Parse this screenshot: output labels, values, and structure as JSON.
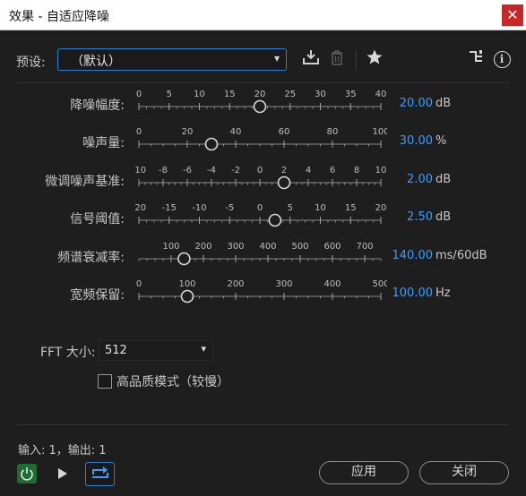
{
  "window": {
    "title": "效果 - 自适应降噪",
    "close_label": "✕"
  },
  "preset": {
    "label": "预设:",
    "value": "（默认）"
  },
  "toolbar_icons": [
    "download-preset-icon",
    "delete-preset-icon",
    "favorite-star-icon",
    "routing-icon",
    "info-icon"
  ],
  "info_glyph": "i",
  "params": [
    {
      "label": "降噪幅度:",
      "value": "20.00",
      "unit": "dB",
      "ticks": [
        "0",
        "5",
        "10",
        "15",
        "20",
        "25",
        "30",
        "35",
        "40"
      ],
      "min": 0,
      "max": 40,
      "current": 20
    },
    {
      "label": "噪声量:",
      "value": "30.00",
      "unit": "%",
      "ticks": [
        "0",
        "20",
        "40",
        "60",
        "80",
        "100"
      ],
      "min": 0,
      "max": 100,
      "current": 30
    },
    {
      "label": "微调噪声基准:",
      "value": "2.00",
      "unit": "dB",
      "ticks": [
        "-10",
        "-8",
        "-6",
        "-4",
        "-2",
        "0",
        "2",
        "4",
        "6",
        "8",
        "10"
      ],
      "min": -10,
      "max": 10,
      "current": 2
    },
    {
      "label": "信号阈值:",
      "value": "2.50",
      "unit": "dB",
      "ticks": [
        "-20",
        "-15",
        "-10",
        "-5",
        "0",
        "5",
        "10",
        "15",
        "20"
      ],
      "min": -20,
      "max": 20,
      "current": 2.5
    },
    {
      "label": "频谱衰减率:",
      "value": "140.00",
      "unit": "ms/60dB",
      "ticks": [
        "100",
        "200",
        "300",
        "400",
        "500",
        "600",
        "700"
      ],
      "min": 0,
      "max": 750,
      "current": 140,
      "tick_start": 100
    },
    {
      "label": "宽频保留:",
      "value": "100.00",
      "unit": "Hz",
      "ticks": [
        "0",
        "100",
        "200",
        "300",
        "400",
        "500"
      ],
      "min": 0,
      "max": 500,
      "current": 100
    }
  ],
  "fft": {
    "label": "FFT 大小:",
    "value": "512"
  },
  "high_quality": {
    "label": "高品质模式（较慢）",
    "checked": false
  },
  "io_text": "输入: 1，输出: 1",
  "buttons": {
    "apply": "应用",
    "close": "关闭"
  },
  "colors": {
    "accent": "#3b9bff",
    "power_on": "#1e6b35",
    "close_red": "#c62828"
  }
}
